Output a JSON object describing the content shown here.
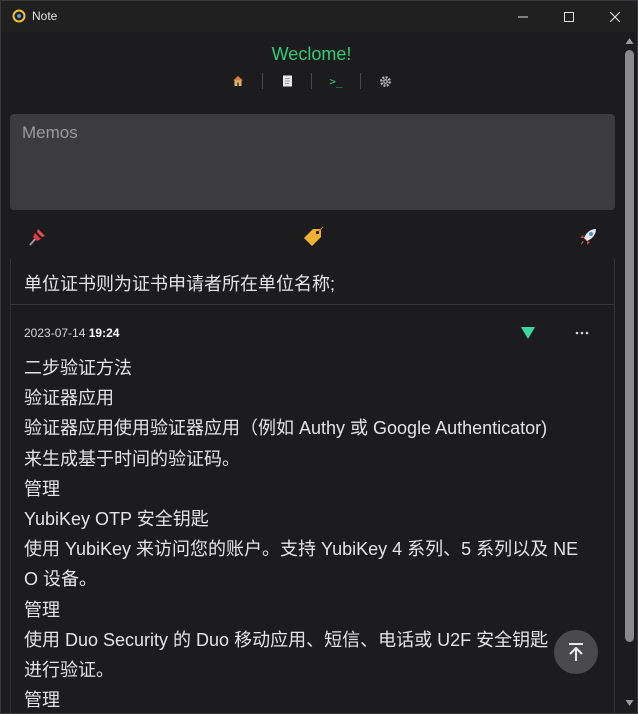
{
  "window": {
    "title": "Note",
    "app_icon": "app-logo-icon",
    "controls": [
      "minimize-icon",
      "maximize-icon",
      "close-icon"
    ]
  },
  "header": {
    "welcome": "Weclome!",
    "nav": {
      "home_icon": "home-icon",
      "notes_icon": "note-icon",
      "terminal_label": ">_",
      "settings_icon": "gear-icon"
    }
  },
  "memo_input": {
    "placeholder": "Memos",
    "value": ""
  },
  "toolbar": {
    "pin_icon": "pin-icon",
    "tag_icon": "tag-icon",
    "send_icon": "rocket-icon"
  },
  "colors": {
    "accent": "#2fca7a",
    "background": "#1c1c1f",
    "input_bg": "#3c3c3e"
  },
  "feed": {
    "previous_line": "单位证书则为证书申请者所在单位名称;",
    "memo": {
      "date": "2023-07-14",
      "time": "19:24",
      "lines": [
        "二步验证方法",
        "验证器应用",
        "验证器应用使用验证器应用（例如 Authy 或 Google Authenticator)",
        "来生成基于时间的验证码。",
        "管理",
        "YubiKey OTP 安全钥匙",
        "使用 YubiKey 来访问您的账户。支持 YubiKey 4 系列、5 系列以及 NE",
        "O 设备。",
        "管理",
        "使用 Duo Security 的 Duo 移动应用、短信、电话或 U2F 安全钥匙",
        "进行验证。",
        "管理"
      ]
    }
  },
  "scroll_to_top_icon": "arrow-up-to-top-icon"
}
